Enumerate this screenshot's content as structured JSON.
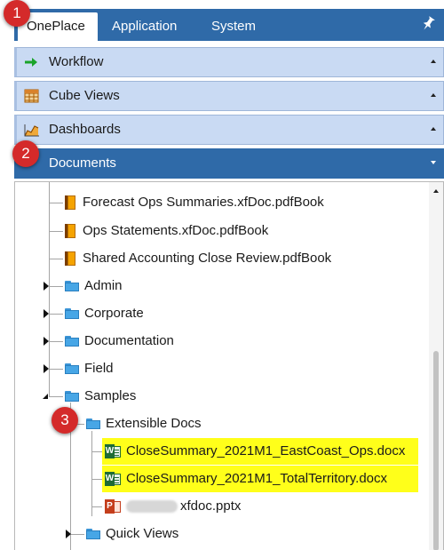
{
  "tabs": [
    {
      "label": "OnePlace",
      "active": true
    },
    {
      "label": "Application",
      "active": false
    },
    {
      "label": "System",
      "active": false
    }
  ],
  "pin_icon": "pin-icon",
  "accordion": {
    "workflow": {
      "label": "Workflow",
      "icon": "arrow-right-icon"
    },
    "cube_views": {
      "label": "Cube Views",
      "icon": "grid-icon"
    },
    "dashboards": {
      "label": "Dashboards",
      "icon": "chart-icon"
    },
    "documents": {
      "label": "Documents",
      "icon": "none",
      "active": true
    }
  },
  "tree": {
    "items": [
      {
        "label": "Forecast Ops Summaries.xfDoc.pdfBook",
        "type": "book"
      },
      {
        "label": "Ops Statements.xfDoc.pdfBook",
        "type": "book"
      },
      {
        "label": "Shared Accounting Close Review.pdfBook",
        "type": "book"
      },
      {
        "label": "Admin",
        "type": "folder",
        "expanded": false
      },
      {
        "label": "Corporate",
        "type": "folder",
        "expanded": false
      },
      {
        "label": "Documentation",
        "type": "folder",
        "expanded": false
      },
      {
        "label": "Field",
        "type": "folder",
        "expanded": false
      },
      {
        "label": "Samples",
        "type": "folder",
        "expanded": true
      },
      {
        "label": "Extensible Docs",
        "type": "folder",
        "expanded": true
      },
      {
        "label": "CloseSummary_2021M1_EastCoast_Ops.docx",
        "type": "word",
        "highlighted": true
      },
      {
        "label": "CloseSummary_2021M1_TotalTerritory.docx",
        "type": "word",
        "highlighted": true
      },
      {
        "label": "xfdoc.pptx",
        "type": "ppt",
        "redacted_prefix": true
      },
      {
        "label": "Quick Views",
        "type": "folder",
        "expanded": false
      }
    ]
  },
  "badges": [
    "1",
    "2",
    "3"
  ],
  "colors": {
    "accent": "#2f6aa8",
    "accordion": "#c9daf3",
    "highlight": "#ffff1a",
    "badge": "#d42a2a"
  }
}
